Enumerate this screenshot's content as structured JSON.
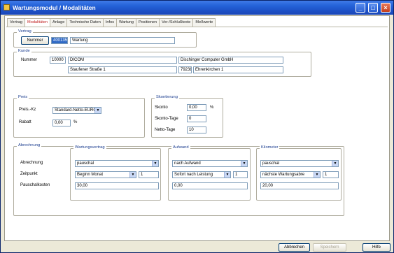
{
  "window": {
    "title": "Wartungsmodul / Modalitäten"
  },
  "tabs": [
    "Vertrag",
    "Modalitäten",
    "Anlage",
    "Technische Daten",
    "Infos",
    "Wartung",
    "Positionen",
    "Vor-/Schlußtexte",
    "Meßwerte"
  ],
  "active_tab": "Modalitäten",
  "vertrag": {
    "legend": "Vertrag",
    "nummer_button": "Nummer",
    "nummer_value": "400135",
    "name_value": "Wartung"
  },
  "kunde": {
    "legend": "Kunde",
    "nummer_label": "Nummer",
    "nummer_value": "10000",
    "kurzname": "DICOM",
    "firma": "Dischinger Computer GmbH",
    "strasse": "Staufener Straße 1",
    "plz": "79238",
    "ort": "Ehrenkirchen 1"
  },
  "preis": {
    "legend": "Preis",
    "kz_label": "Preis.-Kz",
    "kz_value": "Standard-Netto-EURO",
    "rabatt_label": "Rabatt",
    "rabatt_value": "0,00",
    "rabatt_unit": "%"
  },
  "skonto": {
    "legend": "Skontierung",
    "skonto_label": "Skonto",
    "skonto_value": "0,00",
    "skonto_unit": "%",
    "skontotage_label": "Skonto-Tage",
    "skontotage_value": "0",
    "nettotage_label": "Netto-Tage",
    "nettotage_value": "10"
  },
  "abrechnung": {
    "legend": "Abrechnung",
    "row_labels": {
      "abrechnung": "Abrechnung",
      "zeitpunkt": "Zeitpunkt",
      "pauschal": "Pauschalkosten"
    },
    "wartung": {
      "legend": "Wartungsvertrag",
      "abrechnung": "pauschal",
      "zeitpunkt": "Beginn Monat",
      "zeitpunkt_n": "1",
      "kosten": "30,00"
    },
    "aufwand": {
      "legend": "Aufwand",
      "abrechnung": "nach Aufwand",
      "zeitpunkt": "Sofort nach Leistung",
      "zeitpunkt_n": "1",
      "kosten": "0,00"
    },
    "kilometer": {
      "legend": "Kilometer",
      "abrechnung": "pauschal",
      "zeitpunkt": "nächste Wartungsabre",
      "zeitpunkt_n": "1",
      "kosten": "20,00"
    }
  },
  "footer": {
    "abbrechen": "Abbrechen",
    "speichern": "Speichern",
    "hilfe": "Hilfe"
  },
  "colors": {
    "title": "#2563d9",
    "active_tab": "#c02020",
    "legend": "#1b3d8f",
    "selection": "#316ac5"
  }
}
